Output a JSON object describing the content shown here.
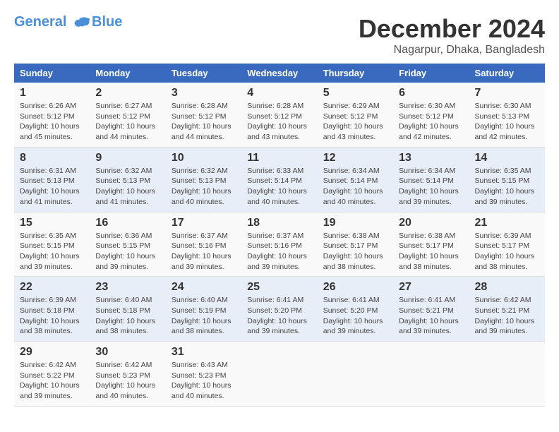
{
  "logo": {
    "general": "General",
    "blue": "Blue"
  },
  "title": "December 2024",
  "subtitle": "Nagarpur, Dhaka, Bangladesh",
  "weekdays": [
    "Sunday",
    "Monday",
    "Tuesday",
    "Wednesday",
    "Thursday",
    "Friday",
    "Saturday"
  ],
  "weeks": [
    [
      {
        "day": "1",
        "sunrise": "Sunrise: 6:26 AM",
        "sunset": "Sunset: 5:12 PM",
        "daylight": "Daylight: 10 hours and 45 minutes."
      },
      {
        "day": "2",
        "sunrise": "Sunrise: 6:27 AM",
        "sunset": "Sunset: 5:12 PM",
        "daylight": "Daylight: 10 hours and 44 minutes."
      },
      {
        "day": "3",
        "sunrise": "Sunrise: 6:28 AM",
        "sunset": "Sunset: 5:12 PM",
        "daylight": "Daylight: 10 hours and 44 minutes."
      },
      {
        "day": "4",
        "sunrise": "Sunrise: 6:28 AM",
        "sunset": "Sunset: 5:12 PM",
        "daylight": "Daylight: 10 hours and 43 minutes."
      },
      {
        "day": "5",
        "sunrise": "Sunrise: 6:29 AM",
        "sunset": "Sunset: 5:12 PM",
        "daylight": "Daylight: 10 hours and 43 minutes."
      },
      {
        "day": "6",
        "sunrise": "Sunrise: 6:30 AM",
        "sunset": "Sunset: 5:12 PM",
        "daylight": "Daylight: 10 hours and 42 minutes."
      },
      {
        "day": "7",
        "sunrise": "Sunrise: 6:30 AM",
        "sunset": "Sunset: 5:13 PM",
        "daylight": "Daylight: 10 hours and 42 minutes."
      }
    ],
    [
      {
        "day": "8",
        "sunrise": "Sunrise: 6:31 AM",
        "sunset": "Sunset: 5:13 PM",
        "daylight": "Daylight: 10 hours and 41 minutes."
      },
      {
        "day": "9",
        "sunrise": "Sunrise: 6:32 AM",
        "sunset": "Sunset: 5:13 PM",
        "daylight": "Daylight: 10 hours and 41 minutes."
      },
      {
        "day": "10",
        "sunrise": "Sunrise: 6:32 AM",
        "sunset": "Sunset: 5:13 PM",
        "daylight": "Daylight: 10 hours and 40 minutes."
      },
      {
        "day": "11",
        "sunrise": "Sunrise: 6:33 AM",
        "sunset": "Sunset: 5:14 PM",
        "daylight": "Daylight: 10 hours and 40 minutes."
      },
      {
        "day": "12",
        "sunrise": "Sunrise: 6:34 AM",
        "sunset": "Sunset: 5:14 PM",
        "daylight": "Daylight: 10 hours and 40 minutes."
      },
      {
        "day": "13",
        "sunrise": "Sunrise: 6:34 AM",
        "sunset": "Sunset: 5:14 PM",
        "daylight": "Daylight: 10 hours and 39 minutes."
      },
      {
        "day": "14",
        "sunrise": "Sunrise: 6:35 AM",
        "sunset": "Sunset: 5:15 PM",
        "daylight": "Daylight: 10 hours and 39 minutes."
      }
    ],
    [
      {
        "day": "15",
        "sunrise": "Sunrise: 6:35 AM",
        "sunset": "Sunset: 5:15 PM",
        "daylight": "Daylight: 10 hours and 39 minutes."
      },
      {
        "day": "16",
        "sunrise": "Sunrise: 6:36 AM",
        "sunset": "Sunset: 5:15 PM",
        "daylight": "Daylight: 10 hours and 39 minutes."
      },
      {
        "day": "17",
        "sunrise": "Sunrise: 6:37 AM",
        "sunset": "Sunset: 5:16 PM",
        "daylight": "Daylight: 10 hours and 39 minutes."
      },
      {
        "day": "18",
        "sunrise": "Sunrise: 6:37 AM",
        "sunset": "Sunset: 5:16 PM",
        "daylight": "Daylight: 10 hours and 39 minutes."
      },
      {
        "day": "19",
        "sunrise": "Sunrise: 6:38 AM",
        "sunset": "Sunset: 5:17 PM",
        "daylight": "Daylight: 10 hours and 38 minutes."
      },
      {
        "day": "20",
        "sunrise": "Sunrise: 6:38 AM",
        "sunset": "Sunset: 5:17 PM",
        "daylight": "Daylight: 10 hours and 38 minutes."
      },
      {
        "day": "21",
        "sunrise": "Sunrise: 6:39 AM",
        "sunset": "Sunset: 5:17 PM",
        "daylight": "Daylight: 10 hours and 38 minutes."
      }
    ],
    [
      {
        "day": "22",
        "sunrise": "Sunrise: 6:39 AM",
        "sunset": "Sunset: 5:18 PM",
        "daylight": "Daylight: 10 hours and 38 minutes."
      },
      {
        "day": "23",
        "sunrise": "Sunrise: 6:40 AM",
        "sunset": "Sunset: 5:18 PM",
        "daylight": "Daylight: 10 hours and 38 minutes."
      },
      {
        "day": "24",
        "sunrise": "Sunrise: 6:40 AM",
        "sunset": "Sunset: 5:19 PM",
        "daylight": "Daylight: 10 hours and 38 minutes."
      },
      {
        "day": "25",
        "sunrise": "Sunrise: 6:41 AM",
        "sunset": "Sunset: 5:20 PM",
        "daylight": "Daylight: 10 hours and 39 minutes."
      },
      {
        "day": "26",
        "sunrise": "Sunrise: 6:41 AM",
        "sunset": "Sunset: 5:20 PM",
        "daylight": "Daylight: 10 hours and 39 minutes."
      },
      {
        "day": "27",
        "sunrise": "Sunrise: 6:41 AM",
        "sunset": "Sunset: 5:21 PM",
        "daylight": "Daylight: 10 hours and 39 minutes."
      },
      {
        "day": "28",
        "sunrise": "Sunrise: 6:42 AM",
        "sunset": "Sunset: 5:21 PM",
        "daylight": "Daylight: 10 hours and 39 minutes."
      }
    ],
    [
      {
        "day": "29",
        "sunrise": "Sunrise: 6:42 AM",
        "sunset": "Sunset: 5:22 PM",
        "daylight": "Daylight: 10 hours and 39 minutes."
      },
      {
        "day": "30",
        "sunrise": "Sunrise: 6:42 AM",
        "sunset": "Sunset: 5:23 PM",
        "daylight": "Daylight: 10 hours and 40 minutes."
      },
      {
        "day": "31",
        "sunrise": "Sunrise: 6:43 AM",
        "sunset": "Sunset: 5:23 PM",
        "daylight": "Daylight: 10 hours and 40 minutes."
      },
      null,
      null,
      null,
      null
    ]
  ]
}
